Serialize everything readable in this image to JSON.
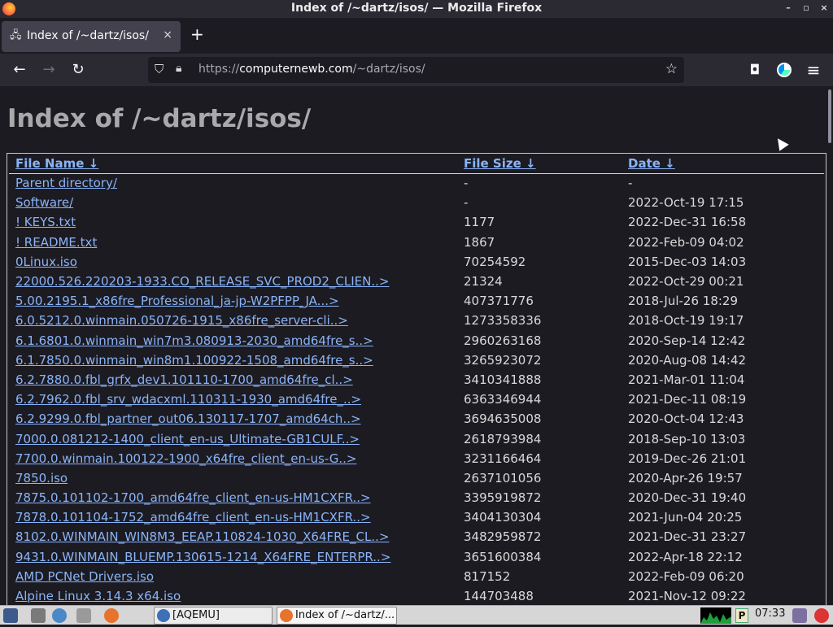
{
  "window": {
    "title": "Index of /~dartz/isos/ — Mozilla Firefox",
    "controls": [
      "–",
      "▫",
      "×"
    ]
  },
  "tab": {
    "label": "Index of /~dartz/isos/",
    "close": "×",
    "new_tab": "+"
  },
  "nav": {
    "back": "←",
    "forward": "→",
    "reload": "↻",
    "url_scheme": "https://",
    "url_host": "computernewb.com",
    "url_path": "/~dartz/isos/",
    "star": "☆",
    "pocket": "◘",
    "menu": "≡"
  },
  "page": {
    "heading": "Index of /~dartz/isos/",
    "columns": {
      "name": "File Name  ↓",
      "size": "File Size  ↓",
      "date": "Date  ↓"
    },
    "rows": [
      {
        "name": "Parent directory/",
        "size": "-",
        "date": "-"
      },
      {
        "name": "Software/",
        "size": "-",
        "date": "2022-Oct-19 17:15"
      },
      {
        "name": "! KEYS.txt",
        "size": "1177",
        "date": "2022-Dec-31 16:58"
      },
      {
        "name": "! README.txt",
        "size": "1867",
        "date": "2022-Feb-09 04:02"
      },
      {
        "name": "0Linux.iso",
        "size": "70254592",
        "date": "2015-Dec-03 14:03"
      },
      {
        "name": "22000.526.220203-1933.CO_RELEASE_SVC_PROD2_CLIEN..>",
        "size": "21324",
        "date": "2022-Oct-29 00:21"
      },
      {
        "name": "5.00.2195.1_x86fre_Professional_ja-jp-W2PFPP_JA...>",
        "size": "407371776",
        "date": "2018-Jul-26 18:29"
      },
      {
        "name": "6.0.5212.0.winmain.050726-1915_x86fre_server-cli..>",
        "size": "1273358336",
        "date": "2018-Oct-19 19:17"
      },
      {
        "name": "6.1.6801.0.winmain_win7m3.080913-2030_amd64fre_s..>",
        "size": "2960263168",
        "date": "2020-Sep-14 12:42"
      },
      {
        "name": "6.1.7850.0.winmain_win8m1.100922-1508_amd64fre_s..>",
        "size": "3265923072",
        "date": "2020-Aug-08 14:42"
      },
      {
        "name": "6.2.7880.0.fbl_grfx_dev1.101110-1700_amd64fre_cl..>",
        "size": "3410341888",
        "date": "2021-Mar-01 11:04"
      },
      {
        "name": "6.2.7962.0.fbl_srv_wdacxml.110311-1930_amd64fre_..>",
        "size": "6363346944",
        "date": "2021-Dec-11 08:19"
      },
      {
        "name": "6.2.9299.0.fbl_partner_out06.130117-1707_amd64ch..>",
        "size": "3694635008",
        "date": "2020-Oct-04 12:43"
      },
      {
        "name": "7000.0.081212-1400_client_en-us_Ultimate-GB1CULF..>",
        "size": "2618793984",
        "date": "2018-Sep-10 13:03"
      },
      {
        "name": "7700.0.winmain.100122-1900_x64fre_client_en-us-G..>",
        "size": "3231166464",
        "date": "2019-Dec-26 21:01"
      },
      {
        "name": "7850.iso",
        "size": "2637101056",
        "date": "2020-Apr-26 19:57"
      },
      {
        "name": "7875.0.101102-1700_amd64fre_client_en-us-HM1CXFR..>",
        "size": "3395919872",
        "date": "2020-Dec-31 19:40"
      },
      {
        "name": "7878.0.101104-1752_amd64fre_client_en-us-HM1CXFR..>",
        "size": "3404130304",
        "date": "2021-Jun-04 20:25"
      },
      {
        "name": "8102.0.WINMAIN_WIN8M3_EEAP.110824-1030_X64FRE_CL..>",
        "size": "3482959872",
        "date": "2021-Dec-31 23:27"
      },
      {
        "name": "9431.0.WINMAIN_BLUEMP.130615-1214_X64FRE_ENTERPR..>",
        "size": "3651600384",
        "date": "2022-Apr-18 22:12"
      },
      {
        "name": "AMD PCNet Drivers.iso",
        "size": "817152",
        "date": "2022-Feb-09 06:20"
      },
      {
        "name": "Alpine Linux 3.14.3 x64.iso",
        "size": "144703488",
        "date": "2021-Nov-12 09:22"
      }
    ]
  },
  "taskbar": {
    "tasks": [
      "[AQEMU]",
      "Index of /~dartz/..."
    ],
    "clock": "07:33",
    "tray_letter": "P"
  },
  "colors": {
    "link": "#8ab4f8",
    "page_bg": "#1c1b22",
    "toolbar_bg": "#2b2a33"
  }
}
